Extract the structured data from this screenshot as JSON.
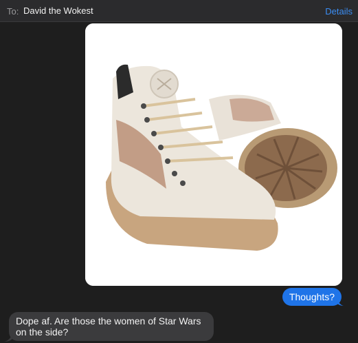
{
  "header": {
    "to_label": "To:",
    "recipient": "David the Wokest",
    "details_label": "Details"
  },
  "messages": [
    {
      "direction": "sent",
      "kind": "image",
      "image_subject": "pair of cream leather high-top lace-up sneakers with floral side panels and gum soles"
    },
    {
      "direction": "sent",
      "kind": "text",
      "text": "Thoughts?"
    },
    {
      "direction": "received",
      "kind": "text",
      "text": "Dope af. Are those the women of Star Wars on the side?"
    }
  ],
  "colors": {
    "sent_bubble": "#1f74e8",
    "received_bubble": "#3b3b3d",
    "link": "#3b8ef5",
    "background": "#1e1e1e"
  }
}
